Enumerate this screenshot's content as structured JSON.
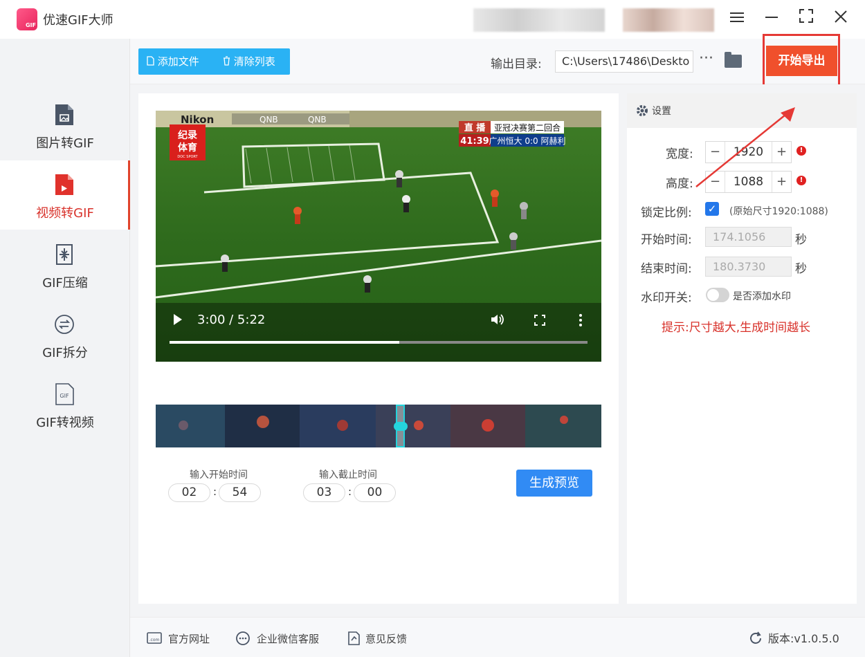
{
  "app": {
    "title": "优速GIF大师",
    "logo_badge": "GIF"
  },
  "sidebar": {
    "items": [
      {
        "label": "图片转GIF",
        "active": false
      },
      {
        "label": "视频转GIF",
        "active": true
      },
      {
        "label": "GIF压缩",
        "active": false
      },
      {
        "label": "GIF拆分",
        "active": false
      },
      {
        "label": "GIF转视频",
        "active": false
      }
    ]
  },
  "toolbar": {
    "add_file_label": "添加文件",
    "clear_list_label": "清除列表",
    "output_dir_label": "输出目录:",
    "output_path": "C:\\Users\\17486\\Deskto",
    "more_label": "···",
    "export_label": "开始导出"
  },
  "video": {
    "time_display": "3:00 / 5:22",
    "progress_fraction": 0.55,
    "logo_line1": "纪录",
    "logo_line2": "体育",
    "logo_sub": "DOC SPORT",
    "live_tag": "直 播",
    "event_title": "亚冠决赛第二回合",
    "match_clock": "41:39",
    "match_score": "广州恒大 0:0 阿赫利",
    "banner_brand": "Nikon",
    "banner_sponsor1": "QNB",
    "banner_sponsor2": "QNB"
  },
  "trim": {
    "start_label": "输入开始时间",
    "end_label": "输入截止时间",
    "start_min": "02",
    "start_sec": "54",
    "end_min": "03",
    "end_sec": "00",
    "preview_button": "生成预览"
  },
  "settings": {
    "header": "设置",
    "width_label": "宽度:",
    "width_value": "1920",
    "height_label": "高度:",
    "height_value": "1088",
    "lock_label": "锁定比例:",
    "lock_checked": true,
    "lock_note": "(原始尺寸1920:1088)",
    "start_label": "开始时间:",
    "start_value": "174.1056",
    "end_label": "结束时间:",
    "end_value": "180.3730",
    "unit": "秒",
    "watermark_label": "水印开关:",
    "watermark_text": "是否添加水印",
    "watermark_on": false,
    "tip": "提示:尺寸越大,生成时间越长"
  },
  "footer": {
    "website": "官方网址",
    "wechat": "企业微信客服",
    "feedback": "意见反馈",
    "version": "版本:v1.0.5.0"
  },
  "colors": {
    "accent_blue": "#318bf4",
    "export_orange": "#f0502c",
    "active_red": "#d8312a",
    "toolbar_cyan": "#2ab2f4"
  }
}
